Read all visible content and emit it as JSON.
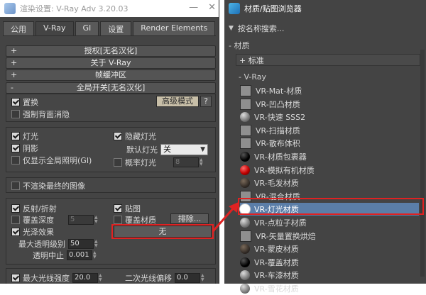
{
  "left_window": {
    "title": "渲染设置: V-Ray Adv 3.20.03",
    "tabs": [
      "公用",
      "V-Ray",
      "GI",
      "设置",
      "Render Elements"
    ],
    "rollouts": {
      "license": "授权[无名汉化]",
      "about": "关于 V-Ray",
      "framebuffer": "帧缓冲区",
      "global": "全局开关[无名汉化]"
    },
    "expand_sign": "+",
    "collapse_sign": "-",
    "displacement": "置换",
    "force_backface": "强制背面消隐",
    "advanced_mode": "高级模式",
    "help": "?",
    "lights": "灯光",
    "hidden_lights": "隐藏灯光",
    "shadows": "阴影",
    "default_lights_label": "默认灯光",
    "default_lights_value": "关",
    "gi_only": "仅显示全局照明(GI)",
    "prob_lights": "概率灯光",
    "prob_lights_value": "8",
    "dont_render_final": "不渲染最终的图像",
    "reflection": "反射/折射",
    "maps": "贴图",
    "override_depth": "覆盖深度",
    "override_depth_value": "5",
    "override_mtl": "覆盖材质",
    "exclude": "排除...",
    "glossy": "光泽效果",
    "override_mtl_slot": "无",
    "max_transp_label": "最大透明级别",
    "max_transp_value": "50",
    "transp_cutoff_label": "透明中止",
    "transp_cutoff_value": "0.001",
    "max_ray_label": "最大光线强度",
    "max_ray_value": "20.0",
    "secondary_bias_label": "二次光线偏移",
    "secondary_bias_value": "0.0"
  },
  "right_window": {
    "title": "材质/贴图浏览器",
    "search_placeholder": "按名称搜索...",
    "group_materials": "- 材质",
    "group_standard": "+ 标准",
    "group_vray": "- V-Ray",
    "materials": [
      {
        "label": "VR-Mat-材质",
        "swatch": "flat"
      },
      {
        "label": "VR-凹凸材质",
        "swatch": "flat"
      },
      {
        "label": "VR-快速 SSS2",
        "swatch": "gray"
      },
      {
        "label": "VR-扫描材质",
        "swatch": "flat"
      },
      {
        "label": "VR-散布体积",
        "swatch": "flat"
      },
      {
        "label": "VR-材质包裹器",
        "swatch": "black"
      },
      {
        "label": "VR-模拟有机材质",
        "swatch": "red"
      },
      {
        "label": "VR-毛发材质",
        "swatch": "dark"
      },
      {
        "label": "VR-混合材质",
        "swatch": "flat"
      },
      {
        "label": "VR-灯光材质",
        "swatch": "white"
      },
      {
        "label": "VR-点粒子材质",
        "swatch": "gray"
      },
      {
        "label": "VR-矢量置换烘焙",
        "swatch": "flat"
      },
      {
        "label": "VR-蒙皮材质",
        "swatch": "dark"
      },
      {
        "label": "VR-覆盖材质",
        "swatch": "black"
      },
      {
        "label": "VR-车漆材质",
        "swatch": "gray"
      },
      {
        "label": "VR-雪花材质",
        "swatch": "gray"
      }
    ],
    "selected_index": 9
  },
  "colors": {
    "panel_bg": "#444444",
    "highlight_red": "#e02222",
    "selection_blue": "#5b7ea8"
  }
}
